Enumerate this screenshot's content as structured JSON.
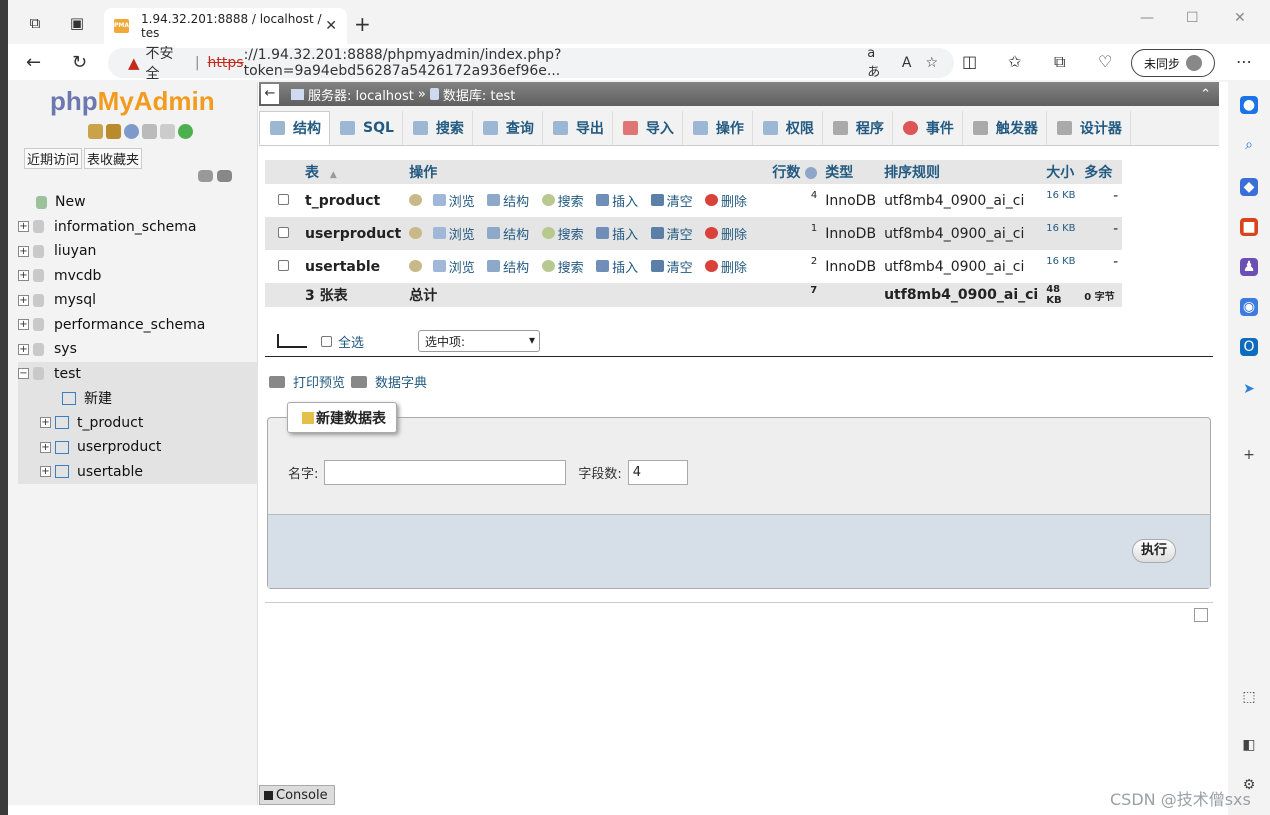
{
  "browser": {
    "tab_title": "1.94.32.201:8888 / localhost / tes",
    "tab_favicon": "PMA",
    "security_label": "不安全",
    "url_https": "https",
    "url_rest": "://1.94.32.201:8888/phpmyadmin/index.php?token=9a94ebd56287a5426172a936ef96e...",
    "read_aloud": "aあ",
    "sync_label": "未同步"
  },
  "pma": {
    "logo_php": "php",
    "logo_myadmin": "MyAdmin",
    "left_links": [
      "近期访问",
      "表收藏夹"
    ],
    "tree": {
      "new_label": "New",
      "databases": [
        "information_schema",
        "liuyan",
        "mvcdb",
        "mysql",
        "performance_schema",
        "sys"
      ],
      "current_db": "test",
      "new_table": "新建",
      "tables": [
        "t_product",
        "userproduct",
        "usertable"
      ]
    },
    "breadcrumb": {
      "server": "服务器: localhost",
      "sep": "»",
      "database": "数据库: test"
    },
    "tabs": [
      "结构",
      "SQL",
      "搜索",
      "查询",
      "导出",
      "导入",
      "操作",
      "权限",
      "程序",
      "事件",
      "触发器",
      "设计器"
    ],
    "table_headers": {
      "table": "表",
      "sort_arrow": "▲",
      "action": "操作",
      "rows": "行数",
      "type": "类型",
      "collation": "排序规则",
      "size": "大小",
      "overhead": "多余"
    },
    "actions": [
      "浏览",
      "结构",
      "搜索",
      "插入",
      "清空",
      "删除"
    ],
    "rows": [
      {
        "name": "t_product",
        "rows": "4",
        "type": "InnoDB",
        "collation": "utf8mb4_0900_ai_ci",
        "size": "16 KB",
        "overhead": "-"
      },
      {
        "name": "userproduct",
        "rows": "1",
        "type": "InnoDB",
        "collation": "utf8mb4_0900_ai_ci",
        "size": "16 KB",
        "overhead": "-"
      },
      {
        "name": "usertable",
        "rows": "2",
        "type": "InnoDB",
        "collation": "utf8mb4_0900_ai_ci",
        "size": "16 KB",
        "overhead": "-"
      }
    ],
    "totals": {
      "count": "3 张表",
      "label": "总计",
      "rows": "7",
      "collation": "utf8mb4_0900_ai_ci",
      "size": "48 KB",
      "overhead": "0 字节"
    },
    "check_all": "全选",
    "with_selected": "选中项:",
    "print_view": "打印预览",
    "data_dictionary": "数据字典",
    "create_table": {
      "legend": "新建数据表",
      "name_label": "名字:",
      "fields_label": "字段数:",
      "fields_value": "4",
      "go_button": "执行"
    },
    "console": "Console"
  },
  "watermark": "CSDN @技术僧sxs"
}
